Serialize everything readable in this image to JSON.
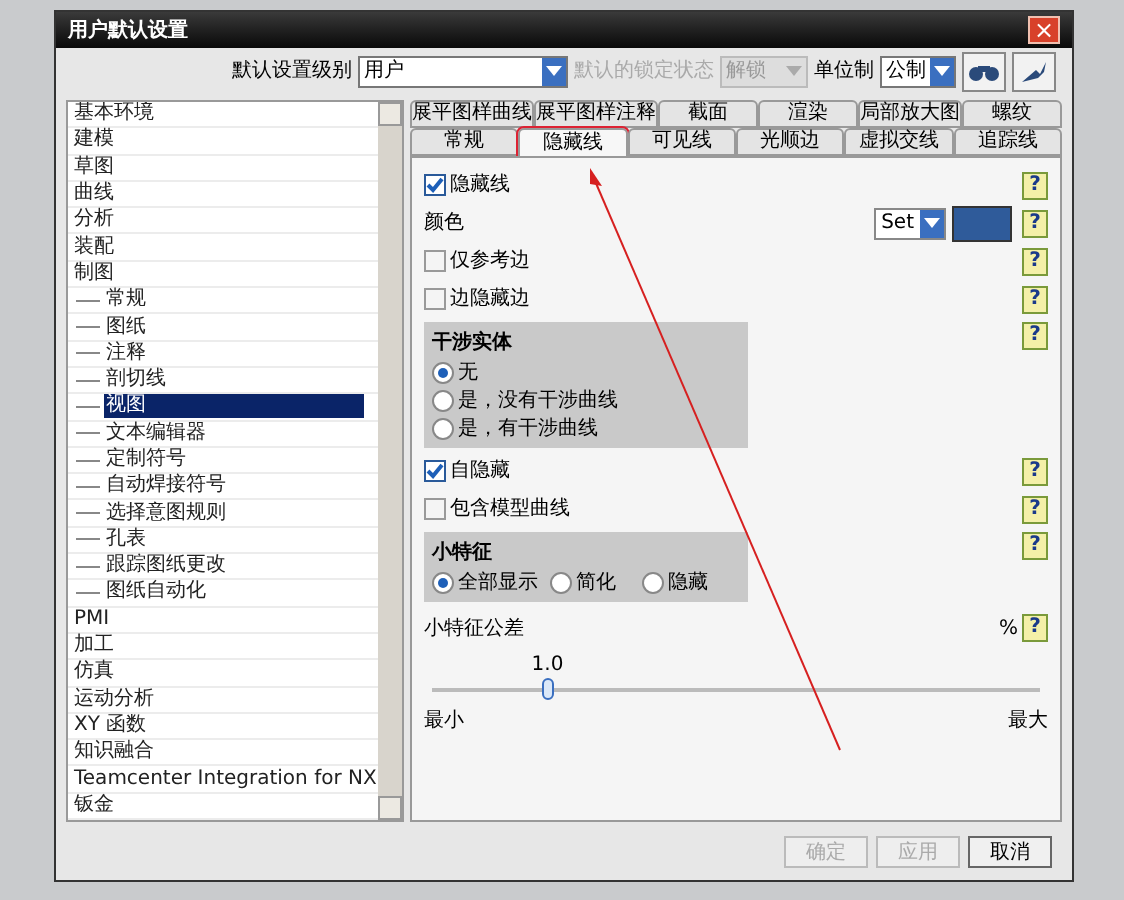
{
  "window": {
    "title": "用户默认设置",
    "close": "×"
  },
  "toolbar": [
    {
      "label": "默认设置级别",
      "value": "用户",
      "disabled": false
    },
    {
      "label": "默认的锁定状态",
      "value": "解锁",
      "disabled": true
    },
    {
      "label": "单位制",
      "value": "公制",
      "disabled": false
    }
  ],
  "tree": [
    {
      "label": "基本环境",
      "selected": false
    },
    {
      "label": "建模",
      "selected": false
    },
    {
      "label": "草图",
      "selected": false
    },
    {
      "label": "曲线",
      "selected": false
    },
    {
      "label": "分析",
      "selected": false
    },
    {
      "label": "装配",
      "selected": false
    },
    {
      "label": "制图",
      "selected": false,
      "children": [
        {
          "label": "常规",
          "selected": false
        },
        {
          "label": "图纸",
          "selected": false
        },
        {
          "label": "注释",
          "selected": false
        },
        {
          "label": "剖切线",
          "selected": false
        },
        {
          "label": "视图",
          "selected": true
        },
        {
          "label": "文本编辑器",
          "selected": false
        },
        {
          "label": "定制符号",
          "selected": false
        },
        {
          "label": "自动焊接符号",
          "selected": false
        },
        {
          "label": "选择意图规则",
          "selected": false
        },
        {
          "label": "孔表",
          "selected": false
        },
        {
          "label": "跟踪图纸更改",
          "selected": false
        },
        {
          "label": "图纸自动化",
          "selected": false
        }
      ]
    },
    {
      "label": "PMI",
      "selected": false
    },
    {
      "label": "加工",
      "selected": false
    },
    {
      "label": "仿真",
      "selected": false
    },
    {
      "label": "运动分析",
      "selected": false
    },
    {
      "label": "XY 函数",
      "selected": false
    },
    {
      "label": "知识融合",
      "selected": false
    },
    {
      "label": "Teamcenter Integration for NX",
      "selected": false
    },
    {
      "label": "钣金",
      "selected": false
    }
  ],
  "tab_rows": [
    [
      {
        "label": "展平图样曲线",
        "selected": false
      },
      {
        "label": "展平图样注释",
        "selected": false
      },
      {
        "label": "截面",
        "selected": false
      },
      {
        "label": "渲染",
        "selected": false
      },
      {
        "label": "局部放大图",
        "selected": false
      },
      {
        "label": "螺纹",
        "selected": false
      }
    ],
    [
      {
        "label": "常规",
        "selected": false
      },
      {
        "label": "隐藏线",
        "selected": true
      },
      {
        "label": "可见线",
        "selected": false
      },
      {
        "label": "光顺边",
        "selected": false
      },
      {
        "label": "虚拟交线",
        "selected": false
      },
      {
        "label": "追踪线",
        "selected": false
      }
    ]
  ],
  "settings": [
    {
      "kind": "checkbox",
      "label": "隐藏线",
      "checked": true,
      "help": "?"
    },
    {
      "kind": "color",
      "label": "颜色",
      "value": "Set",
      "color": "#2f5b9a",
      "help": "?"
    },
    {
      "kind": "checkbox",
      "label": "仅参考边",
      "checked": false,
      "help": "?"
    },
    {
      "kind": "checkbox",
      "label": "边隐藏边",
      "checked": false,
      "help": "?"
    },
    {
      "kind": "radio_group",
      "title": "干涉实体",
      "help": "?",
      "options": [
        {
          "label": "无",
          "selected": true
        },
        {
          "label": "是，没有干涉曲线",
          "selected": false
        },
        {
          "label": "是，有干涉曲线",
          "selected": false
        }
      ]
    },
    {
      "kind": "checkbox",
      "label": "自隐藏",
      "checked": true,
      "help": "?"
    },
    {
      "kind": "checkbox",
      "label": "包含模型曲线",
      "checked": false,
      "help": "?"
    },
    {
      "kind": "radio_row",
      "title": "小特征",
      "help": "?",
      "options": [
        {
          "label": "全部显示",
          "selected": true
        },
        {
          "label": "简化",
          "selected": false
        },
        {
          "label": "隐藏",
          "selected": false
        }
      ]
    },
    {
      "kind": "slider",
      "label": "小特征公差",
      "unit": "%",
      "help": "?",
      "value": "1.0",
      "level": 0.19,
      "min": "最小",
      "max": "最大"
    }
  ],
  "buttons": [
    {
      "label": "确定",
      "disabled": true
    },
    {
      "label": "应用",
      "disabled": true
    },
    {
      "label": "取消",
      "disabled": false
    }
  ]
}
